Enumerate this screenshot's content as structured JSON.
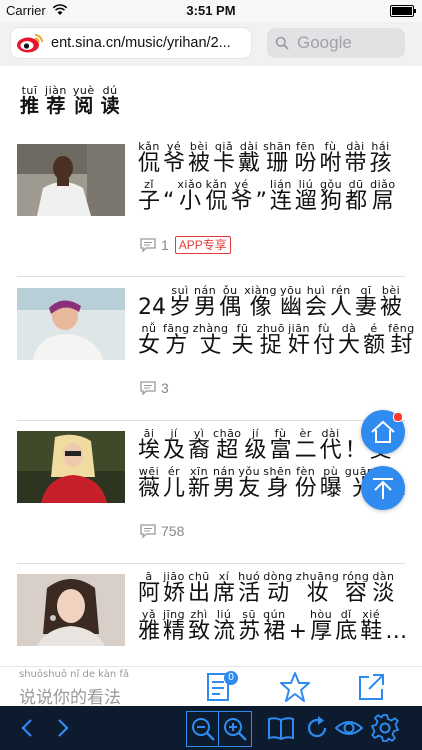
{
  "status": {
    "carrier": "Carrier",
    "time": "3:51 PM"
  },
  "address": {
    "url": "ent.sina.cn/music/yrihan/2...",
    "search_placeholder": "Google"
  },
  "section": {
    "chars": [
      {
        "py": "tuī",
        "hz": "推"
      },
      {
        "py": "jiàn",
        "hz": "荐"
      },
      {
        "py": "yuè",
        "hz": "阅"
      },
      {
        "py": "dú",
        "hz": "读"
      }
    ]
  },
  "articles": [
    {
      "lines": [
        [
          {
            "py": "kǎn",
            "hz": "侃"
          },
          {
            "py": "yé",
            "hz": "爷"
          },
          {
            "py": "bèi",
            "hz": "被"
          },
          {
            "py": "qiǎ",
            "hz": "卡"
          },
          {
            "py": "dài",
            "hz": "戴"
          },
          {
            "py": "shān",
            "hz": "珊"
          },
          {
            "py": "fēn",
            "hz": "吩"
          },
          {
            "py": "fù",
            "hz": "咐"
          },
          {
            "py": "dài",
            "hz": "带"
          },
          {
            "py": "hái",
            "hz": "孩"
          }
        ],
        [
          {
            "py": "zǐ",
            "hz": "子"
          },
          {
            "py": "",
            "hz": "“"
          },
          {
            "py": "xiǎo",
            "hz": "小"
          },
          {
            "py": "kǎn",
            "hz": "侃"
          },
          {
            "py": "yé",
            "hz": "爷"
          },
          {
            "py": "",
            "hz": "”"
          },
          {
            "py": "lián",
            "hz": "连"
          },
          {
            "py": "liú",
            "hz": "遛"
          },
          {
            "py": "gǒu",
            "hz": "狗"
          },
          {
            "py": "dū",
            "hz": "都"
          },
          {
            "py": "diǎo",
            "hz": "屌"
          }
        ]
      ],
      "comment_count": "1",
      "badge": "APP专享"
    },
    {
      "lines": [
        [
          {
            "py": "",
            "hz": "24"
          },
          {
            "py": "suì",
            "hz": "岁"
          },
          {
            "py": "nán",
            "hz": "男"
          },
          {
            "py": "ǒu",
            "hz": "偶"
          },
          {
            "py": "xiàng",
            "hz": "像"
          },
          {
            "py": "yōu",
            "hz": "幽"
          },
          {
            "py": "huì",
            "hz": "会"
          },
          {
            "py": "rén",
            "hz": "人"
          },
          {
            "py": "qī",
            "hz": "妻"
          },
          {
            "py": "bèi",
            "hz": "被"
          }
        ],
        [
          {
            "py": "nǚ",
            "hz": "女"
          },
          {
            "py": "fāng",
            "hz": "方"
          },
          {
            "py": "zhàng",
            "hz": "丈"
          },
          {
            "py": "fū",
            "hz": "夫"
          },
          {
            "py": "zhuō",
            "hz": "捉"
          },
          {
            "py": "jiān",
            "hz": "奸"
          },
          {
            "py": "fù",
            "hz": "付"
          },
          {
            "py": "dà",
            "hz": "大"
          },
          {
            "py": "é",
            "hz": "额"
          },
          {
            "py": "fēng",
            "hz": "封"
          }
        ]
      ],
      "comment_count": "3",
      "badge": ""
    },
    {
      "lines": [
        [
          {
            "py": "āi",
            "hz": "埃"
          },
          {
            "py": "jí",
            "hz": "及"
          },
          {
            "py": "yì",
            "hz": "裔"
          },
          {
            "py": "chāo",
            "hz": "超"
          },
          {
            "py": "jí",
            "hz": "级"
          },
          {
            "py": "fù",
            "hz": "富"
          },
          {
            "py": "èr",
            "hz": "二"
          },
          {
            "py": "dài",
            "hz": "代"
          },
          {
            "py": "",
            "hz": "！"
          },
          {
            "py": "",
            "hz": "艾"
          }
        ],
        [
          {
            "py": "wēi",
            "hz": "薇"
          },
          {
            "py": "ér",
            "hz": "儿"
          },
          {
            "py": "xīn",
            "hz": "新"
          },
          {
            "py": "nán",
            "hz": "男"
          },
          {
            "py": "yǒu",
            "hz": "友"
          },
          {
            "py": "shēn",
            "hz": "身"
          },
          {
            "py": "fèn",
            "hz": "份"
          },
          {
            "py": "pù",
            "hz": "曝"
          },
          {
            "py": "guāng",
            "hz": "光"
          },
          {
            "py": "",
            "hz": "…"
          }
        ]
      ],
      "comment_count": "758",
      "badge": ""
    },
    {
      "lines": [
        [
          {
            "py": "ā",
            "hz": "阿"
          },
          {
            "py": "jiāo",
            "hz": "娇"
          },
          {
            "py": "chū",
            "hz": "出"
          },
          {
            "py": "xí",
            "hz": "席"
          },
          {
            "py": "huó",
            "hz": "活"
          },
          {
            "py": "dòng",
            "hz": "动"
          },
          {
            "py": "zhuāng",
            "hz": "妆"
          },
          {
            "py": "róng",
            "hz": "容"
          },
          {
            "py": "dàn",
            "hz": "淡"
          }
        ],
        [
          {
            "py": "yǎ",
            "hz": "雅"
          },
          {
            "py": "jīng",
            "hz": "精"
          },
          {
            "py": "zhì",
            "hz": "致"
          },
          {
            "py": "liú",
            "hz": "流"
          },
          {
            "py": "sū",
            "hz": "苏"
          },
          {
            "py": "qún",
            "hz": "裙"
          },
          {
            "py": "",
            "hz": "+"
          },
          {
            "py": "hòu",
            "hz": "厚"
          },
          {
            "py": "dǐ",
            "hz": "底"
          },
          {
            "py": "xié",
            "hz": "鞋"
          },
          {
            "py": "",
            "hz": "…"
          }
        ]
      ],
      "comment_count": "",
      "badge": ""
    }
  ],
  "comment_bar": {
    "pinyin": "shuōshuō nǐ de kàn fǎ",
    "placeholder": "说说你的看法",
    "count": "0"
  },
  "icons": {
    "comment": "comment-bubble-icon",
    "star": "star-icon",
    "share": "share-icon",
    "home": "home-icon",
    "top": "scroll-to-top-icon",
    "back": "back-arrow-icon",
    "forward": "forward-arrow-icon",
    "zoom_out": "zoom-out-icon",
    "zoom_in": "zoom-in-icon",
    "reader": "book-icon",
    "reload": "reload-icon",
    "eye": "eye-icon",
    "settings": "gear-icon"
  },
  "colors": {
    "accent": "#2f8bf0",
    "toolbar_bg": "#0c1b2e",
    "badge": "#e43a3a"
  }
}
